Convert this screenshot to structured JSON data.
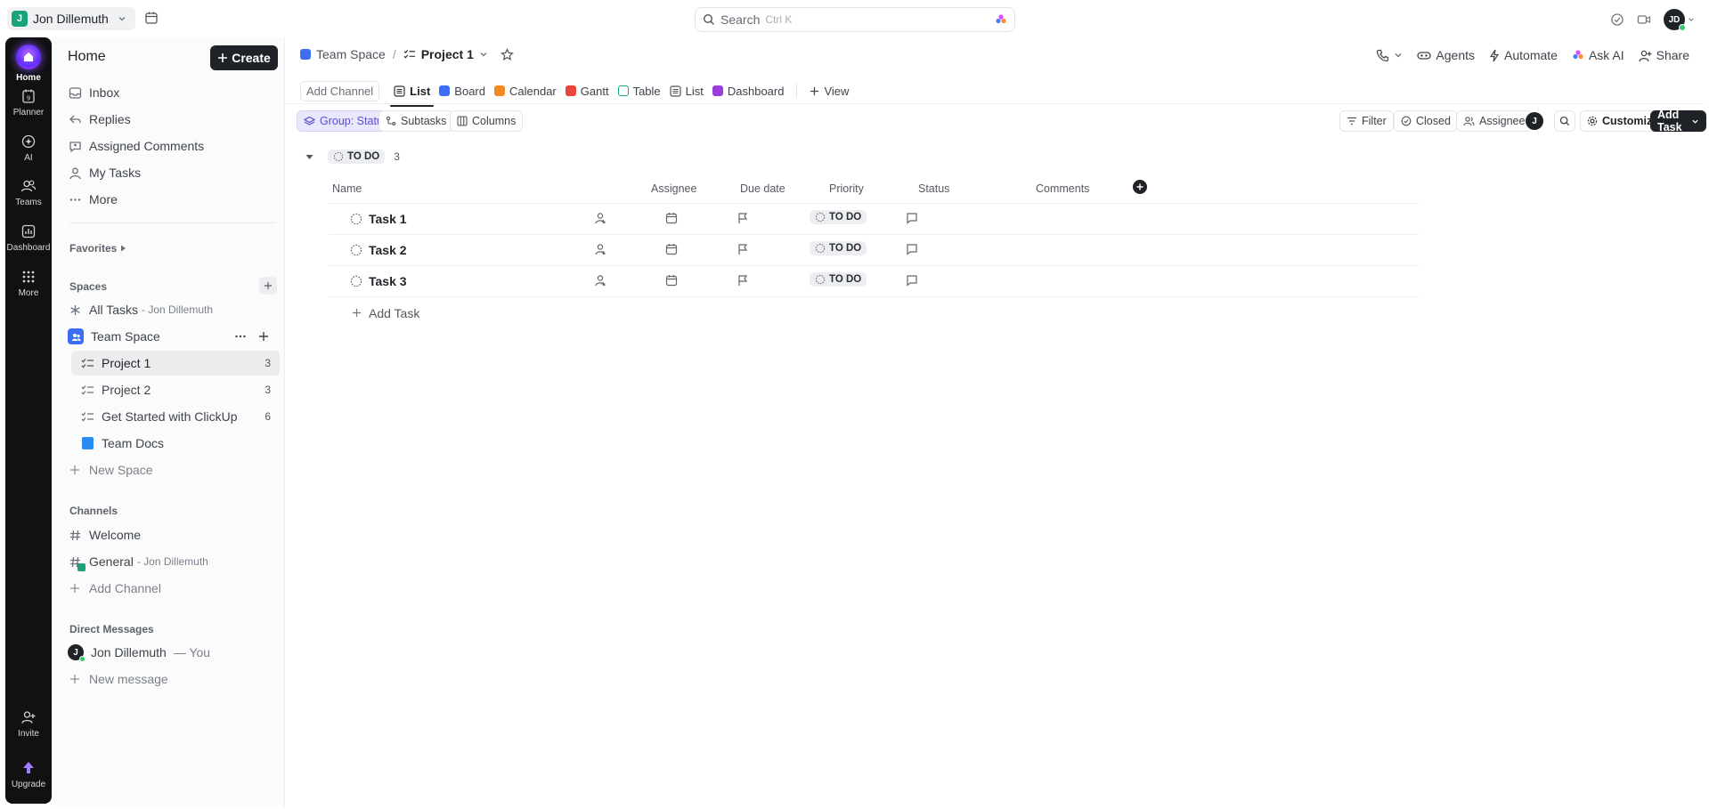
{
  "topbar": {
    "workspace_initial": "J",
    "workspace_name": "Jon Dillemuth",
    "search_label": "Search",
    "search_shortcut": "Ctrl K",
    "user_initials": "JD"
  },
  "rail": {
    "items": [
      {
        "label": "Home"
      },
      {
        "label": "Planner",
        "badge": "9"
      },
      {
        "label": "AI"
      },
      {
        "label": "Teams"
      },
      {
        "label": "Dashboard"
      },
      {
        "label": "More"
      },
      {
        "label": "Invite"
      },
      {
        "label": "Upgrade"
      }
    ]
  },
  "sidebar": {
    "title": "Home",
    "create_label": "Create",
    "nav": [
      {
        "label": "Inbox"
      },
      {
        "label": "Replies"
      },
      {
        "label": "Assigned Comments"
      },
      {
        "label": "My Tasks"
      },
      {
        "label": "More"
      }
    ],
    "favorites_label": "Favorites",
    "spaces_label": "Spaces",
    "all_tasks": {
      "label": "All Tasks",
      "owner": "- Jon Dillemuth"
    },
    "team_space": "Team Space",
    "lists": [
      {
        "label": "Project 1",
        "count": "3"
      },
      {
        "label": "Project 2",
        "count": "3"
      },
      {
        "label": "Get Started with ClickUp",
        "count": "6"
      },
      {
        "label": "Team Docs",
        "count": ""
      }
    ],
    "new_space": "New Space",
    "channels_label": "Channels",
    "channels": [
      {
        "label": "Welcome",
        "owner": ""
      },
      {
        "label": "General",
        "owner": "- Jon Dillemuth"
      }
    ],
    "add_channel": "Add Channel",
    "dm_label": "Direct Messages",
    "dm_user": {
      "initial": "J",
      "name": "Jon Dillemuth",
      "suffix": "— You"
    },
    "new_message": "New message"
  },
  "main": {
    "breadcrumb": {
      "space": "Team Space",
      "sep": "/",
      "project": "Project 1"
    },
    "header_actions": {
      "agents": "Agents",
      "automate": "Automate",
      "ask_ai": "Ask AI",
      "share": "Share"
    },
    "add_channel": "Add Channel",
    "views": [
      "List",
      "Board",
      "Calendar",
      "Gantt",
      "Table",
      "List",
      "Dashboard"
    ],
    "add_view": "View",
    "toolbar": {
      "group": "Group: Status",
      "subtasks": "Subtasks",
      "columns": "Columns",
      "filter": "Filter",
      "closed": "Closed",
      "assignee": "Assignee",
      "assignee_initial": "J",
      "customize": "Customize",
      "add_task": "Add Task"
    },
    "group": {
      "status": "TO DO",
      "count": "3"
    },
    "columns": {
      "name": "Name",
      "assignee": "Assignee",
      "due": "Due date",
      "priority": "Priority",
      "status": "Status",
      "comments": "Comments"
    },
    "tasks": [
      {
        "name": "Task 1",
        "status": "TO DO"
      },
      {
        "name": "Task 2",
        "status": "TO DO"
      },
      {
        "name": "Task 3",
        "status": "TO DO"
      }
    ],
    "add_task_label": "Add Task"
  },
  "colors": {
    "accent": "#7b68ee",
    "rail_bg": "#111111",
    "dark_button": "#1f2328",
    "space_blue": "#3d6df2"
  }
}
